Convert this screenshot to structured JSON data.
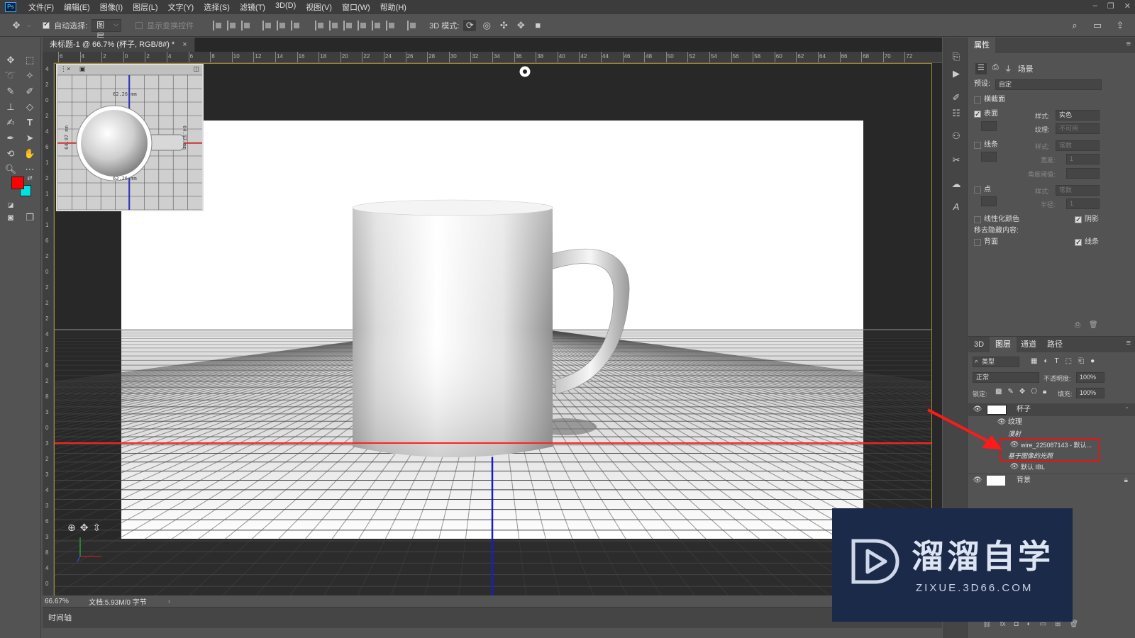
{
  "app": {
    "logo": "Ps"
  },
  "menu": [
    "文件(F)",
    "编辑(E)",
    "图像(I)",
    "图层(L)",
    "文字(Y)",
    "选择(S)",
    "滤镜(T)",
    "3D(D)",
    "视图(V)",
    "窗口(W)",
    "帮助(H)"
  ],
  "window_controls": [
    "–",
    "❐",
    "✕"
  ],
  "options": {
    "auto_select_label": "自动选择:",
    "auto_select_value": "图层",
    "show_transform_label": "显示变换控件",
    "mode_3d_label": "3D 模式:"
  },
  "document": {
    "tab_title": "未标题-1 @ 66.7% (杯子, RGB/8#) *",
    "tab_close": "×",
    "zoom": "66.67%",
    "doc_info": "文档:5.93M/0 字节",
    "timeline_label": "时间轴"
  },
  "ruler_h": [
    "6",
    "4",
    "2",
    "0",
    "2",
    "4",
    "6",
    "8",
    "10",
    "12",
    "14",
    "16",
    "18",
    "20",
    "22",
    "24",
    "26",
    "28",
    "30",
    "32",
    "34",
    "36",
    "38",
    "40",
    "42",
    "44",
    "46",
    "48",
    "50",
    "52",
    "54",
    "56",
    "58",
    "60",
    "62",
    "64",
    "66",
    "68",
    "70",
    "72"
  ],
  "ruler_v": [
    "4",
    "2",
    "0",
    "2",
    "4",
    "6",
    "1",
    "2",
    "1",
    "4",
    "1",
    "6",
    "2",
    "0",
    "2",
    "2",
    "2",
    "4",
    "2",
    "6",
    "2",
    "8",
    "3",
    "0",
    "3",
    "2",
    "3",
    "4",
    "3",
    "6",
    "3",
    "8",
    "4",
    "0"
  ],
  "secondary_view": {
    "dim_top": "62.26 mm",
    "dim_bottom": "62.26 mm",
    "dim_left": "64.97 mm",
    "dim_right": "64.97 mm"
  },
  "properties": {
    "title": "属性",
    "scene_tab": "场景",
    "preset_label": "预设:",
    "preset_value": "自定",
    "cross_section_label": "横截面",
    "surface_label": "表面",
    "surface_style_label": "样式:",
    "surface_style_value": "实色",
    "surface_texture_label": "纹理:",
    "surface_texture_value": "不可用",
    "lines_label": "线条",
    "lines_style_label": "样式:",
    "lines_style_value": "常数",
    "lines_width_label": "宽度:",
    "lines_width_value": "1",
    "lines_angle_label": "角度阈值:",
    "points_label": "点",
    "points_style_label": "样式:",
    "points_style_value": "常数",
    "points_radius_label": "半径:",
    "points_radius_value": "1",
    "linearize_label": "线性化颜色",
    "shadow_label": "阴影",
    "remove_hidden_label": "移去隐藏内容:",
    "backface_label": "背面",
    "lines2_label": "线条"
  },
  "layers_panel": {
    "tabs": [
      "3D",
      "图层",
      "通道",
      "路径"
    ],
    "active_tab": "图层",
    "filter_value": "类型",
    "blend_mode": "正常",
    "opacity_label": "不透明度:",
    "opacity_value": "100%",
    "lock_label": "锁定:",
    "fill_label": "填充:",
    "fill_value": "100%",
    "layers": [
      {
        "name": "杯子",
        "kind": "3d"
      },
      {
        "name": "纹理",
        "kind": "sub"
      },
      {
        "name": "漫射",
        "kind": "italic"
      },
      {
        "name": "wire_225087143 - 默认...",
        "kind": "highlight"
      },
      {
        "name": "基于图像的光照",
        "kind": "italic-highlight"
      },
      {
        "name": "默认 IBL",
        "kind": "sub2"
      },
      {
        "name": "背景",
        "kind": "bg"
      }
    ]
  },
  "watermark": {
    "title": "溜溜自学",
    "url": "ZIXUE.3D66.COM"
  },
  "colors": {
    "foreground": "#ff0000",
    "background": "#00e0e0",
    "highlight_box": "#e31414",
    "arrow": "#ff1a1a",
    "ground_line": "#ff2222",
    "vertical_axis": "#1a1acc"
  }
}
